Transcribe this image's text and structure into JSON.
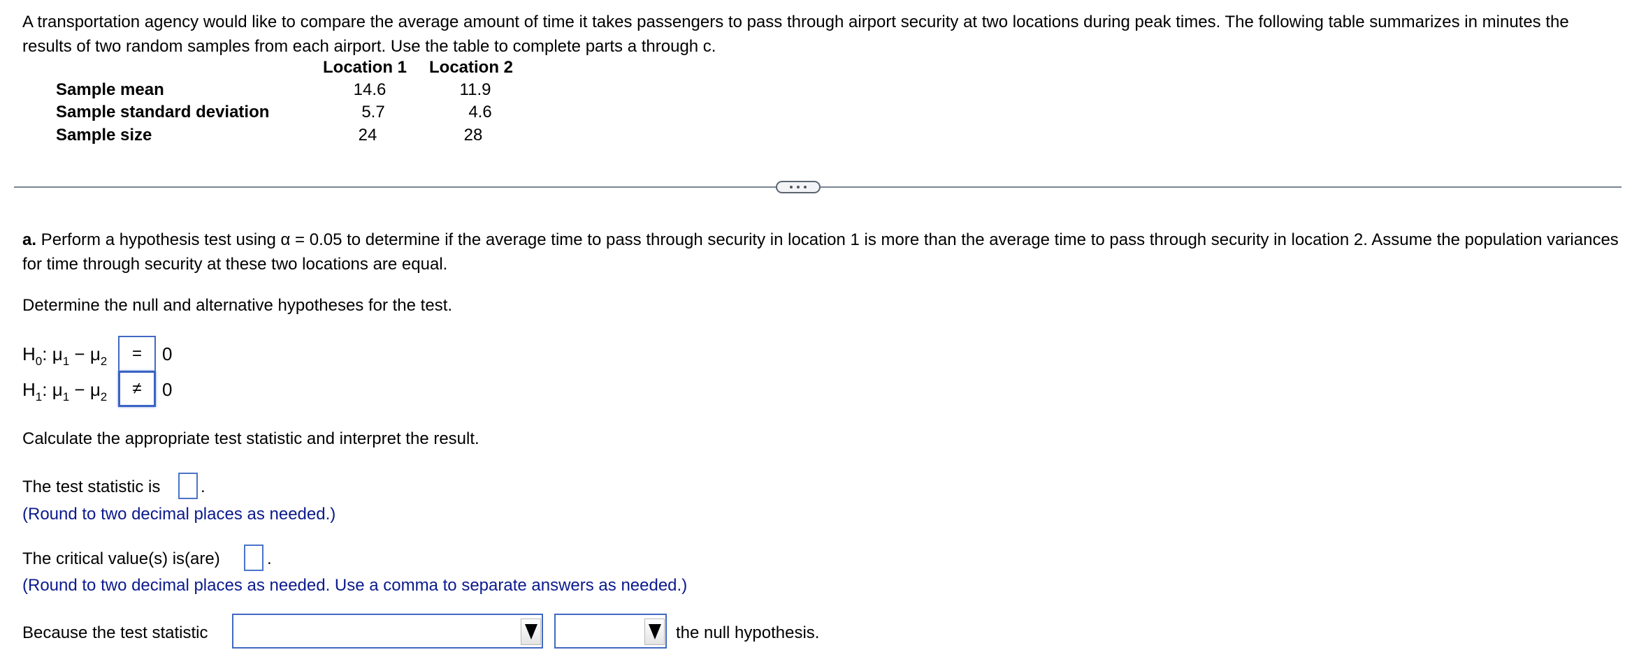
{
  "intro": {
    "text": "A transportation agency would like to compare the average amount of time it takes passengers to pass through airport security at two locations during peak times. The following table summarizes in minutes the results of two random samples from each airport. Use the table to complete parts a through c."
  },
  "table": {
    "columns": [
      "Location 1",
      "Location 2"
    ],
    "rows": [
      {
        "label": "Sample mean",
        "values": [
          "14.6",
          "11.9"
        ]
      },
      {
        "label": "Sample standard deviation",
        "values": [
          "5.7",
          "4.6"
        ]
      },
      {
        "label": "Sample size",
        "values": [
          "24",
          "28"
        ]
      }
    ]
  },
  "divider": {
    "icon": "more-horizontal-icon"
  },
  "part_a": {
    "label": "a.",
    "text_before_alpha": " Perform a hypothesis test using ",
    "alpha_symbol": "α",
    "text_after_alpha": " = 0.05 to determine if the average time to pass through security in location 1 is more than the average time to pass through security in location 2. Assume the population variances for time through security at these two locations are equal.",
    "hypotheses_prompt": "Determine the null and alternative hypotheses for the test.",
    "h0": {
      "H": "H",
      "sub": "0",
      "colon": ":",
      "mu": "μ",
      "mu1sub": "1",
      "minus": " − ",
      "mu2sub": "2",
      "operator": "=",
      "rhs": "0"
    },
    "h1": {
      "H": "H",
      "sub": "1",
      "colon": ":",
      "mu": "μ",
      "mu1sub": "1",
      "minus": " − ",
      "mu2sub": "2",
      "operator": "≠",
      "rhs": "0"
    },
    "calc_prompt": "Calculate the appropriate test statistic and interpret the result.",
    "test_statistic_label": "The test statistic is",
    "test_statistic_value": "",
    "test_statistic_hint": "(Round to two decimal places as needed.)",
    "critical_label": "The critical value(s) is(are)",
    "critical_value": "",
    "critical_hint": "(Round to two decimal places as needed. Use a comma to separate answers as needed.)",
    "because_label": "Because the test statistic",
    "dropdown1_value": "",
    "dropdown2_value": "",
    "conclusion_suffix": "the null hypothesis.",
    "period": "."
  }
}
